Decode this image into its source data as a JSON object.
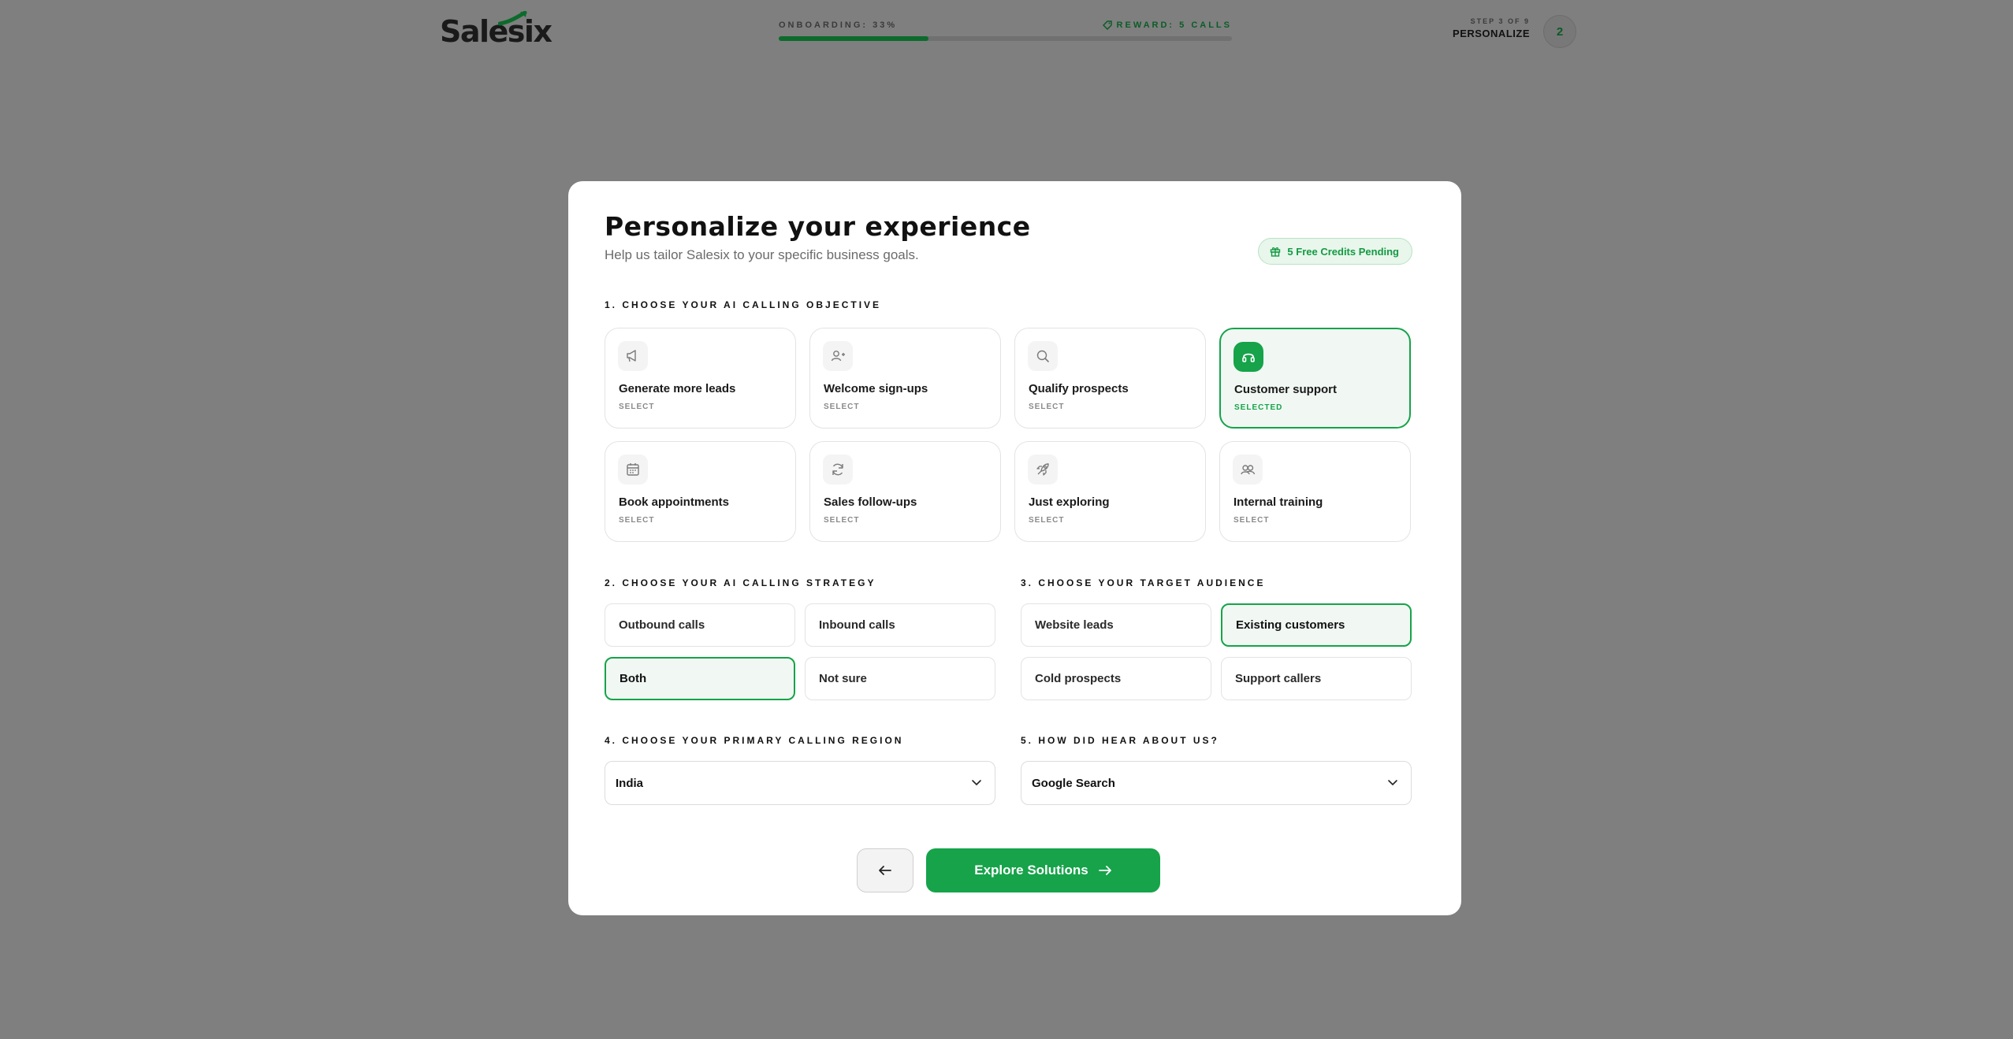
{
  "topbar": {
    "logo_text": "Salesix",
    "progress_label": "ONBOARDING: 33%",
    "progress_fraction": 0.33,
    "reward_label": "REWARD: 5 CALLS",
    "step_count": "STEP 3 OF 9",
    "step_name": "PERSONALIZE",
    "step_badge": "2"
  },
  "modal": {
    "title": "Personalize your experience",
    "subtitle": "Help us tailor Salesix to your specific business goals.",
    "credits_pill": "5 Free Credits Pending"
  },
  "objective": {
    "label": "1. CHOOSE YOUR AI CALLING OBJECTIVE",
    "cards": [
      {
        "title": "Generate more leads",
        "status": "SELECT",
        "icon": "megaphone-icon",
        "selected": false
      },
      {
        "title": "Welcome sign-ups",
        "status": "SELECT",
        "icon": "user-plus-icon",
        "selected": false
      },
      {
        "title": "Qualify prospects",
        "status": "SELECT",
        "icon": "search-icon",
        "selected": false
      },
      {
        "title": "Customer support",
        "status": "SELECTED",
        "icon": "headset-icon",
        "selected": true
      },
      {
        "title": "Book appointments",
        "status": "SELECT",
        "icon": "calendar-icon",
        "selected": false
      },
      {
        "title": "Sales follow-ups",
        "status": "SELECT",
        "icon": "refresh-icon",
        "selected": false
      },
      {
        "title": "Just exploring",
        "status": "SELECT",
        "icon": "rocket-icon",
        "selected": false
      },
      {
        "title": "Internal training",
        "status": "SELECT",
        "icon": "users-icon",
        "selected": false
      }
    ]
  },
  "strategy": {
    "label": "2. CHOOSE YOUR AI CALLING STRATEGY",
    "options": [
      {
        "label": "Outbound calls",
        "selected": false
      },
      {
        "label": "Inbound calls",
        "selected": false
      },
      {
        "label": "Both",
        "selected": true
      },
      {
        "label": "Not sure",
        "selected": false
      }
    ]
  },
  "audience": {
    "label": "3. CHOOSE YOUR TARGET AUDIENCE",
    "options": [
      {
        "label": "Website leads",
        "selected": false
      },
      {
        "label": "Existing customers",
        "selected": true
      },
      {
        "label": "Cold prospects",
        "selected": false
      },
      {
        "label": "Support callers",
        "selected": false
      }
    ]
  },
  "region": {
    "label": "4. CHOOSE YOUR PRIMARY CALLING REGION",
    "value": "India"
  },
  "source": {
    "label": "5. HOW DID HEAR ABOUT US?",
    "value": "Google Search"
  },
  "footer": {
    "cta_label": "Explore Solutions"
  },
  "colors": {
    "accent": "#16a34a",
    "overlay": "#7f7f7f",
    "selected_bg": "#f1f8f3"
  }
}
